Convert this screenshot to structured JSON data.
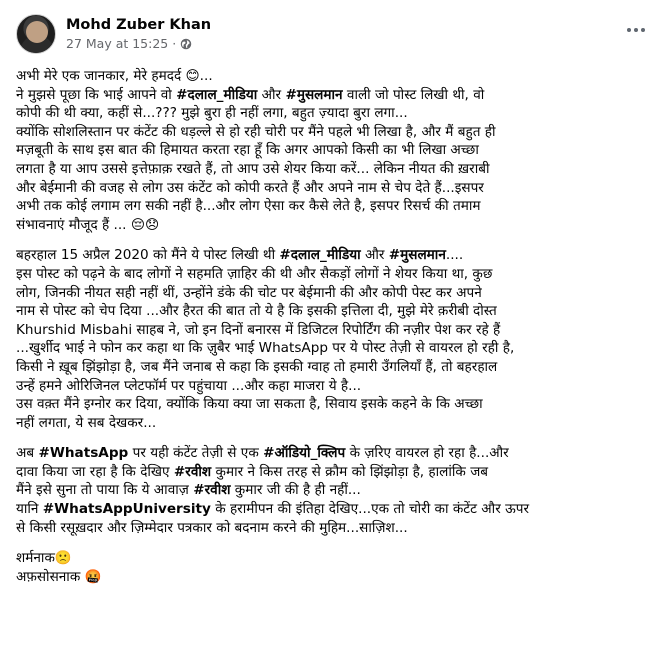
{
  "post": {
    "author": "Mohd Zuber Khan",
    "timestamp": "27 May at 15:25 ·",
    "privacy_icon": "globe-icon",
    "more_icon": "more-options-icon",
    "paragraphs": [
      [
        "अभी मेरे एक जानकार, मेरे हमदर्द 😊...",
        "ने मुझसे पूछा कि भाई आपने वो #दलाल_मीडिया और #मुसलमान वाली जो पोस्ट लिखी थी, वो",
        "कोपी की थी क्या, कहीं से...??? मुझे बुरा ही नहीं लगा, बहुत ज़्यादा बुरा लगा...",
        "क्योंकि सोशलिस्तान पर कंटेंट की धड़ल्ले से हो रही चोरी पर मैंने पहले भी लिखा है, और मैं बहुत ही",
        "मज़बूती के साथ इस बात की हिमायत करता रहा हूँ कि अगर आपको किसी का भी लिखा अच्छा",
        "लगता है या आप उससे इत्तेफ़ाक़ रखते हैं, तो आप उसे शेयर किया करें... लेकिन नीयत की ख़राबी",
        "और बेईमानी की वजह से लोग उस कंटेंट को कोपी करते हैं और अपने नाम से चेप देते हैं...इसपर",
        "अभी तक कोई लगाम लग सकी नहीं है...और लोग ऐसा कर कैसे लेते है, इसपर रिसर्च की तमाम",
        "संभावनाएं मौजूद हैं ... 😔😞"
      ],
      [
        "बहरहाल 15 अप्रैल 2020 को मैंने ये पोस्ट लिखी थी #दलाल_मीडिया और #मुसलमान....",
        "इस पोस्ट को पढ़ने के बाद लोगों ने सहमति ज़ाहिर की थी और सैकड़ों लोगों ने शेयर किया था, कुछ",
        "लोग, जिनकी नीयत सही नहीं थीं, उन्होंने डंके की चोट पर बेईमानी की और कोपी पेस्ट कर अपने",
        "नाम से पोस्ट को चेप दिया ...और हैरत की बात तो ये है कि इसकी इत्तिला दी, मुझे मेरे क़रीबी दोस्त",
        "Khurshid Misbahi साहब ने, जो इन दिनों बनारस में डिजिटल रिपोर्टिंग की नज़ीर पेश कर रहे हैं",
        "...खुर्शीद भाई ने फोन कर कहा था कि ज़ुबैर भाई WhatsApp पर ये पोस्ट तेज़ी से वायरल हो रही है,",
        "किसी ने ख़ूब झिंझोड़ा है, जब मैंने जनाब से कहा कि इसकी ग्वाह तो हमारी उँगलियाँ हैं, तो बहरहाल",
        "उन्हें हमने ओरिजिनल प्लेटफॉर्म पर पहुंचाया ...और कहा माजरा ये है...",
        "उस वक़्त मैंने इग्नोर कर दिया, क्योंकि किया क्या जा सकता है, सिवाय इसके कहने के कि अच्छा",
        "नहीं लगता, ये सब देखकर..."
      ],
      [
        "अब #WhatsApp पर यही कंटेंट तेज़ी से एक #ऑडियो_क्लिप के ज़रिए वायरल हो रहा है...और",
        "दावा किया जा रहा है कि देखिए #रवीश कुमार ने किस तरह से क्रौम को झिंझोड़ा है, हालांकि जब",
        "मैंने इसे सुना तो पाया कि ये आवाज़ #रवीश कुमार जी की है ही नहीं...",
        "यानि #WhatsAppUniversity के हरामीपन की इंतिहा देखिए...एक तो चोरी का कंटेंट और ऊपर",
        "से किसी रसूख़दार और ज़िम्मेदार पत्रकार को बदनाम करने की मुहिम...साज़िश..."
      ],
      [
        "शर्मनाक🙁",
        "अफ़सोसनाक 🤬"
      ]
    ]
  }
}
